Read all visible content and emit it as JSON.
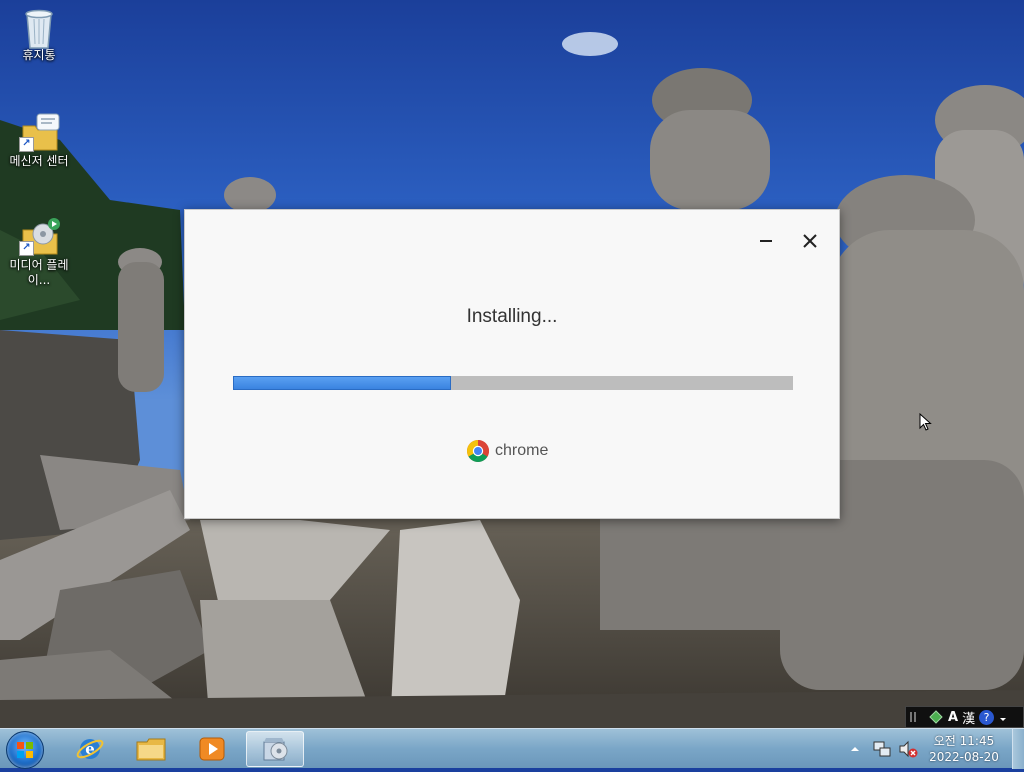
{
  "desktop": {
    "icons": [
      {
        "label": "휴지통",
        "icon": "recycle-bin-icon"
      },
      {
        "label": "메신저 센터",
        "icon": "messenger-center-icon"
      },
      {
        "label": "미디어 플레이...",
        "icon": "media-player-icon"
      }
    ]
  },
  "installer": {
    "status": "Installing...",
    "progress": 0.39,
    "brand": "chrome",
    "minimize_icon": "minimize-icon",
    "close_icon": "close-icon",
    "accent_color": "#3a83e0"
  },
  "language_bar": {
    "mode": "A",
    "hanja": "漢",
    "help": "?"
  },
  "taskbar": {
    "items": [
      {
        "name": "internet-explorer"
      },
      {
        "name": "file-explorer"
      },
      {
        "name": "media-player"
      },
      {
        "name": "chrome-installer",
        "active": true
      }
    ],
    "clock": {
      "time": "오전 11:45",
      "date": "2022-08-20"
    }
  }
}
